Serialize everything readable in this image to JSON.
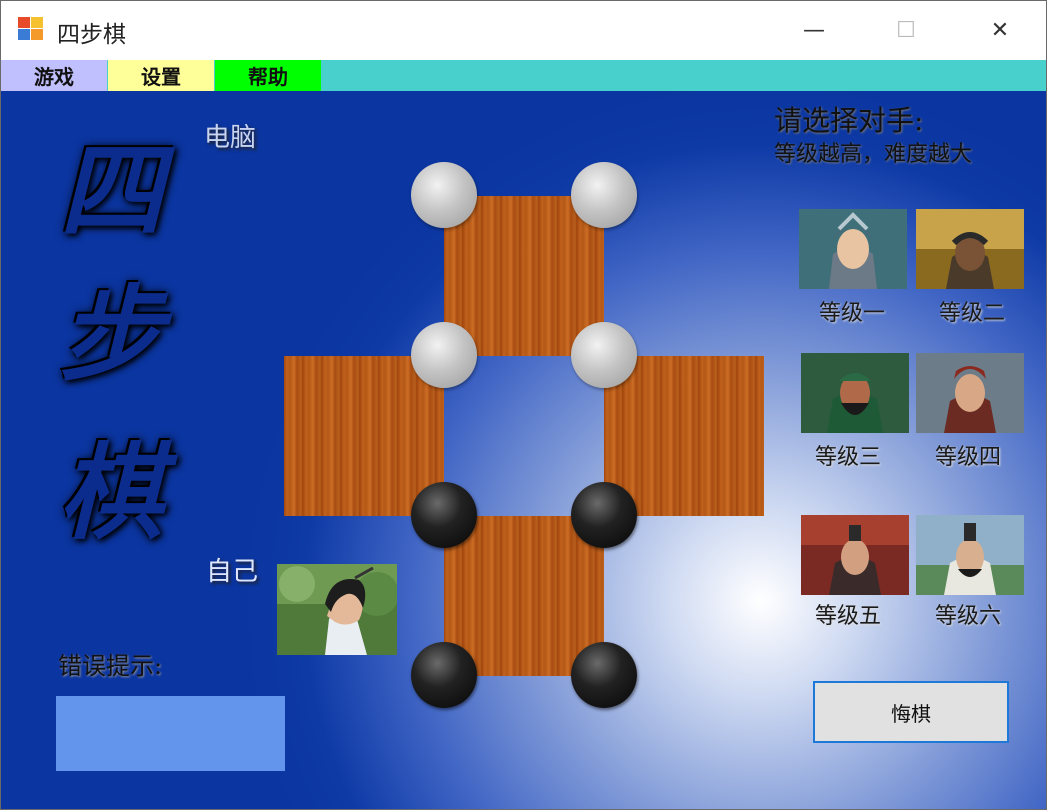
{
  "window": {
    "title": "四步棋",
    "minimize_glyph": "—",
    "maximize_glyph": "☐",
    "close_glyph": "✕"
  },
  "menu": {
    "items": [
      {
        "label": "游戏",
        "color": "#c0c0ff"
      },
      {
        "label": "设置",
        "color": "#ffff99"
      },
      {
        "label": "帮助",
        "color": "#00ff00"
      }
    ],
    "bar_color": "#48d1cc"
  },
  "game": {
    "logo_chars": [
      "四",
      "步",
      "棋"
    ],
    "computer_label": "电脑",
    "self_label": "自己",
    "error_label": "错误提示:",
    "error_text": "",
    "undo_label": "悔棋",
    "pieces": {
      "computer_color": "white",
      "player_color": "black"
    }
  },
  "opponents": {
    "title": "请选择对手:",
    "subtitle": "等级越高，难度越大",
    "levels": [
      {
        "label": "等级一"
      },
      {
        "label": "等级二"
      },
      {
        "label": "等级三"
      },
      {
        "label": "等级四"
      },
      {
        "label": "等级五"
      },
      {
        "label": "等级六"
      }
    ]
  }
}
